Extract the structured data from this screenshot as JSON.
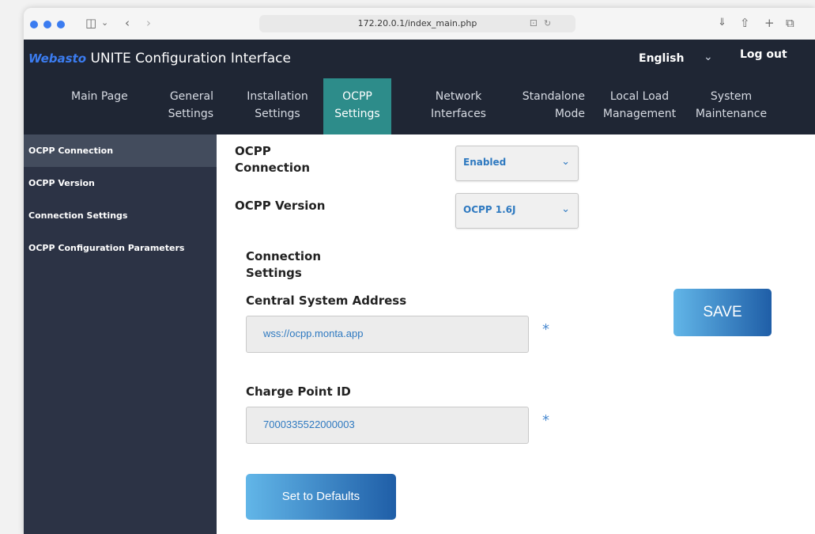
{
  "browser": {
    "url": "172.20.0.1/index_main.php",
    "icons": [
      "sidebar-toggle-icon",
      "chevron-down-icon",
      "back-icon",
      "forward-icon",
      "translate-icon",
      "reload-icon",
      "download-icon",
      "share-icon",
      "new-tab-icon",
      "tabs-icon"
    ]
  },
  "header": {
    "logo_text": "Webasto",
    "title": "UNITE Configuration Interface",
    "language": "English",
    "logout": "Log out"
  },
  "nav": [
    {
      "line1": "Main Page",
      "line2": ""
    },
    {
      "line1": "General",
      "line2": "Settings"
    },
    {
      "line1": "Installation",
      "line2": "Settings"
    },
    {
      "line1": "OCPP",
      "line2": "Settings"
    },
    {
      "line1": "Network",
      "line2": "Interfaces"
    },
    {
      "line1": "Standalone",
      "line2": "Mode"
    },
    {
      "line1": "Local Load",
      "line2": "Management"
    },
    {
      "line1": "System",
      "line2": "Maintenance"
    }
  ],
  "active_nav": "OCPP Settings",
  "sidebar": [
    {
      "label": "OCPP Connection"
    },
    {
      "label": "OCPP Version"
    },
    {
      "label": "Connection Settings"
    },
    {
      "label": "OCPP Configuration Parameters"
    }
  ],
  "main": {
    "ocpp_connection": {
      "label_line1": "OCPP",
      "label_line2": "Connection",
      "value": "Enabled"
    },
    "ocpp_version": {
      "label": "OCPP Version",
      "value": "OCPP 1.6J"
    },
    "connection_settings": {
      "line1": "Connection",
      "line2": "Settings"
    },
    "central_system_address": {
      "label": "Central System Address",
      "value": "wss://ocpp.monta.app",
      "required_mark": "*"
    },
    "charge_point_id": {
      "label": "Charge Point ID",
      "value": "7000335522000003",
      "required_mark": "*"
    },
    "save_label": "SAVE",
    "defaults_label": "Set to Defaults"
  },
  "colors": {
    "header_bg": "#1f2634",
    "sidebar_bg": "#2c3345",
    "active_tab": "#2d8c8a",
    "accent_blue": "#2e79c0"
  }
}
